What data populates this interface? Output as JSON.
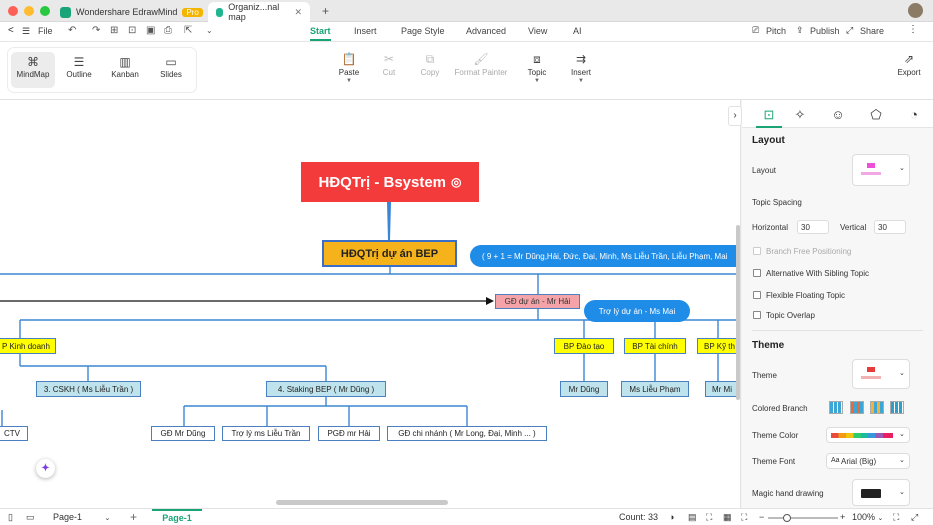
{
  "titlebar": {
    "app_tab": "Wondershare EdrawMind",
    "pro_badge": "Pro",
    "doc_tab": "Organiz...nal map",
    "new_tab": "+"
  },
  "menubar": {
    "back": "<",
    "file": "File",
    "tabs": [
      "Start",
      "Insert",
      "Page Style",
      "Advanced",
      "View",
      "AI"
    ],
    "active_tab": "Start",
    "pitch": "Pitch",
    "publish": "Publish",
    "share": "Share"
  },
  "toolbar": {
    "views": [
      {
        "label": "MindMap",
        "icon": "⌘"
      },
      {
        "label": "Outline",
        "icon": "☰"
      },
      {
        "label": "Kanban",
        "icon": "▥"
      },
      {
        "label": "Slides",
        "icon": "▭"
      }
    ],
    "paste": "Paste",
    "cut": "Cut",
    "copy": "Copy",
    "format_painter": "Format Painter",
    "topic": "Topic",
    "insert": "Insert",
    "export": "Export"
  },
  "mindmap": {
    "root": "HĐQTrị - Bsystem",
    "level1": "HĐQTrị dự án BEP",
    "level1_callout": "( 9 + 1 = Mr Dũng,Hải, Đức, Đại, Minh, Ms Liễu Trần, Liễu Phạm, Mai",
    "director": "GĐ dự án - Mr Hải",
    "assistant_callout": "Trợ lý dự án - Ms Mai",
    "dept_sales": "P Kinh doanh",
    "dept_training": "BP Đào tạo",
    "dept_finance": "BP Tài chính",
    "dept_tech": "BP Kỹ th",
    "cskh": "3. CSKH ( Ms Liễu Trần )",
    "staking": "4. Staking BEP ( Mr Dũng )",
    "training_person": "Mr Dũng",
    "finance_person": "Ms Liễu Phạm",
    "tech_person": "Mr Mi",
    "ctv": "CTV",
    "staking_children": [
      "GĐ Mr Dũng",
      "Trợ lý ms Liễu Trần",
      "PGĐ mr Hải",
      "GĐ chi nhánh ( Mr Long, Đại, Minh ... )"
    ]
  },
  "panel": {
    "layout_heading": "Layout",
    "layout_label": "Layout",
    "topic_spacing": "Topic Spacing",
    "horizontal_label": "Horizontal",
    "horizontal_value": "30",
    "vertical_label": "Vertical",
    "vertical_value": "30",
    "branch_free": "Branch Free Positioning",
    "align_sibling": "Alternative With Sibling Topic",
    "flexible_floating": "Flexible Floating Topic",
    "topic_overlap": "Topic Overlap",
    "theme_heading": "Theme",
    "theme_label": "Theme",
    "colored_branch": "Colored Branch",
    "theme_color": "Theme Color",
    "theme_font": "Theme Font",
    "theme_font_value": "Arial (Big)",
    "magic_hand": "Magic hand drawing"
  },
  "statusbar": {
    "page_select": "Page-1",
    "add_page": "+",
    "active_page": "Page-1",
    "count": "Count: 33",
    "zoom": "100%"
  }
}
